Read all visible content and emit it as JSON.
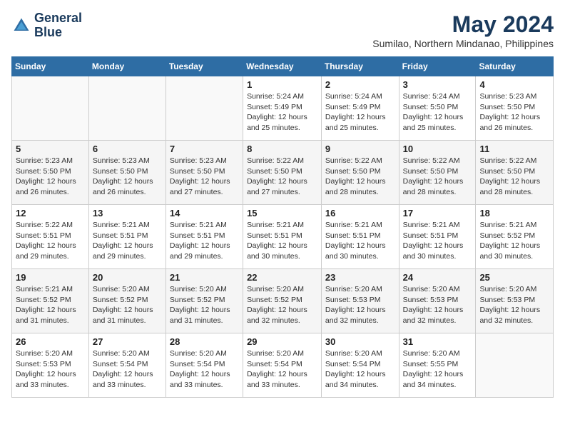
{
  "logo": {
    "line1": "General",
    "line2": "Blue"
  },
  "title": "May 2024",
  "location": "Sumilao, Northern Mindanao, Philippines",
  "weekdays": [
    "Sunday",
    "Monday",
    "Tuesday",
    "Wednesday",
    "Thursday",
    "Friday",
    "Saturday"
  ],
  "weeks": [
    [
      {
        "day": "",
        "info": ""
      },
      {
        "day": "",
        "info": ""
      },
      {
        "day": "",
        "info": ""
      },
      {
        "day": "1",
        "info": "Sunrise: 5:24 AM\nSunset: 5:49 PM\nDaylight: 12 hours\nand 25 minutes."
      },
      {
        "day": "2",
        "info": "Sunrise: 5:24 AM\nSunset: 5:49 PM\nDaylight: 12 hours\nand 25 minutes."
      },
      {
        "day": "3",
        "info": "Sunrise: 5:24 AM\nSunset: 5:50 PM\nDaylight: 12 hours\nand 25 minutes."
      },
      {
        "day": "4",
        "info": "Sunrise: 5:23 AM\nSunset: 5:50 PM\nDaylight: 12 hours\nand 26 minutes."
      }
    ],
    [
      {
        "day": "5",
        "info": "Sunrise: 5:23 AM\nSunset: 5:50 PM\nDaylight: 12 hours\nand 26 minutes."
      },
      {
        "day": "6",
        "info": "Sunrise: 5:23 AM\nSunset: 5:50 PM\nDaylight: 12 hours\nand 26 minutes."
      },
      {
        "day": "7",
        "info": "Sunrise: 5:23 AM\nSunset: 5:50 PM\nDaylight: 12 hours\nand 27 minutes."
      },
      {
        "day": "8",
        "info": "Sunrise: 5:22 AM\nSunset: 5:50 PM\nDaylight: 12 hours\nand 27 minutes."
      },
      {
        "day": "9",
        "info": "Sunrise: 5:22 AM\nSunset: 5:50 PM\nDaylight: 12 hours\nand 28 minutes."
      },
      {
        "day": "10",
        "info": "Sunrise: 5:22 AM\nSunset: 5:50 PM\nDaylight: 12 hours\nand 28 minutes."
      },
      {
        "day": "11",
        "info": "Sunrise: 5:22 AM\nSunset: 5:50 PM\nDaylight: 12 hours\nand 28 minutes."
      }
    ],
    [
      {
        "day": "12",
        "info": "Sunrise: 5:22 AM\nSunset: 5:51 PM\nDaylight: 12 hours\nand 29 minutes."
      },
      {
        "day": "13",
        "info": "Sunrise: 5:21 AM\nSunset: 5:51 PM\nDaylight: 12 hours\nand 29 minutes."
      },
      {
        "day": "14",
        "info": "Sunrise: 5:21 AM\nSunset: 5:51 PM\nDaylight: 12 hours\nand 29 minutes."
      },
      {
        "day": "15",
        "info": "Sunrise: 5:21 AM\nSunset: 5:51 PM\nDaylight: 12 hours\nand 30 minutes."
      },
      {
        "day": "16",
        "info": "Sunrise: 5:21 AM\nSunset: 5:51 PM\nDaylight: 12 hours\nand 30 minutes."
      },
      {
        "day": "17",
        "info": "Sunrise: 5:21 AM\nSunset: 5:51 PM\nDaylight: 12 hours\nand 30 minutes."
      },
      {
        "day": "18",
        "info": "Sunrise: 5:21 AM\nSunset: 5:52 PM\nDaylight: 12 hours\nand 30 minutes."
      }
    ],
    [
      {
        "day": "19",
        "info": "Sunrise: 5:21 AM\nSunset: 5:52 PM\nDaylight: 12 hours\nand 31 minutes."
      },
      {
        "day": "20",
        "info": "Sunrise: 5:20 AM\nSunset: 5:52 PM\nDaylight: 12 hours\nand 31 minutes."
      },
      {
        "day": "21",
        "info": "Sunrise: 5:20 AM\nSunset: 5:52 PM\nDaylight: 12 hours\nand 31 minutes."
      },
      {
        "day": "22",
        "info": "Sunrise: 5:20 AM\nSunset: 5:52 PM\nDaylight: 12 hours\nand 32 minutes."
      },
      {
        "day": "23",
        "info": "Sunrise: 5:20 AM\nSunset: 5:53 PM\nDaylight: 12 hours\nand 32 minutes."
      },
      {
        "day": "24",
        "info": "Sunrise: 5:20 AM\nSunset: 5:53 PM\nDaylight: 12 hours\nand 32 minutes."
      },
      {
        "day": "25",
        "info": "Sunrise: 5:20 AM\nSunset: 5:53 PM\nDaylight: 12 hours\nand 32 minutes."
      }
    ],
    [
      {
        "day": "26",
        "info": "Sunrise: 5:20 AM\nSunset: 5:53 PM\nDaylight: 12 hours\nand 33 minutes."
      },
      {
        "day": "27",
        "info": "Sunrise: 5:20 AM\nSunset: 5:54 PM\nDaylight: 12 hours\nand 33 minutes."
      },
      {
        "day": "28",
        "info": "Sunrise: 5:20 AM\nSunset: 5:54 PM\nDaylight: 12 hours\nand 33 minutes."
      },
      {
        "day": "29",
        "info": "Sunrise: 5:20 AM\nSunset: 5:54 PM\nDaylight: 12 hours\nand 33 minutes."
      },
      {
        "day": "30",
        "info": "Sunrise: 5:20 AM\nSunset: 5:54 PM\nDaylight: 12 hours\nand 34 minutes."
      },
      {
        "day": "31",
        "info": "Sunrise: 5:20 AM\nSunset: 5:55 PM\nDaylight: 12 hours\nand 34 minutes."
      },
      {
        "day": "",
        "info": ""
      }
    ]
  ]
}
